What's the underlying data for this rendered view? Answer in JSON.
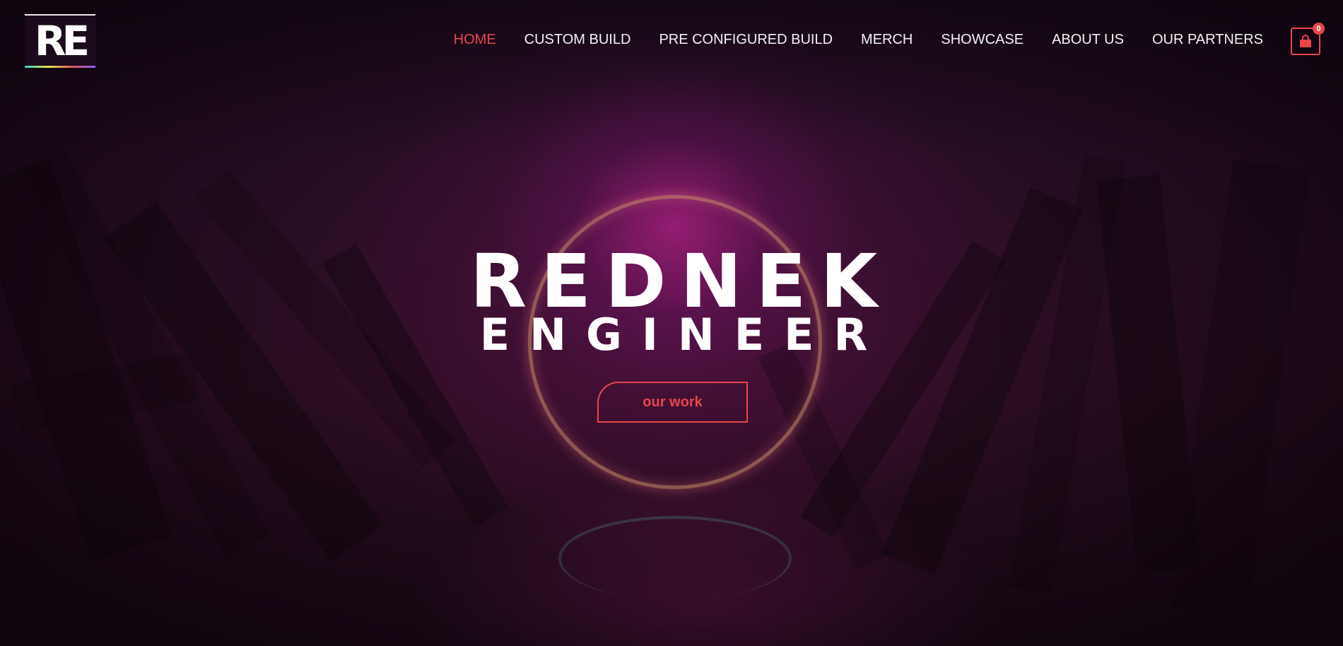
{
  "brand": {
    "logo_text": "RE"
  },
  "nav": {
    "items": [
      {
        "label": "HOME",
        "active": true
      },
      {
        "label": "CUSTOM BUILD",
        "active": false
      },
      {
        "label": "PRE CONFIGURED BUILD",
        "active": false
      },
      {
        "label": "MERCH",
        "active": false
      },
      {
        "label": "SHOWCASE",
        "active": false
      },
      {
        "label": "ABOUT US",
        "active": false
      },
      {
        "label": "OUR PARTNERS",
        "active": false
      }
    ]
  },
  "cart": {
    "icon": "shopping-bag-icon",
    "count": "0"
  },
  "hero": {
    "title_line1": "REDNEK",
    "title_line2": "ENGINEER",
    "cta_label": "our work"
  },
  "colors": {
    "accent": "#e8474a",
    "text": "#ffffff",
    "background": "#1b0a1c"
  }
}
